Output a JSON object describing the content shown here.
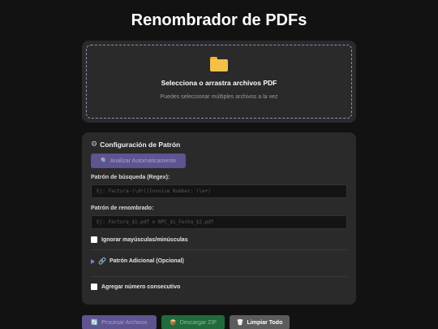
{
  "page": {
    "title": "Renombrador de PDFs"
  },
  "dropzone": {
    "icon": "folder-icon",
    "title": "Selecciona o arrastra archivos PDF",
    "subtitle": "Puedes seleccionar múltiples archivos a la vez"
  },
  "config": {
    "title": "Configuración de Patrón",
    "title_icon": "gear-icon",
    "analyze_label": "Analizar Automáticamente",
    "search_label": "Patrón de búsqueda (Regex):",
    "search_placeholder": "Ej: Factura-(\\d+)|Invoice Number: (\\w+)",
    "rename_label": "Patrón de renombrado:",
    "rename_placeholder": "Ej: Factura_$1.pdf o NPC_$1_Fecha_$2.pdf",
    "ignore_case_label": "Ignorar mayúsculas/minúsculas",
    "ignore_case_checked": false,
    "additional_label": "Patrón Adicional (Opcional)",
    "consecutive_label": "Agregar número consecutivo",
    "consecutive_checked": false
  },
  "actions": {
    "process_label": "Procesar Archivos",
    "zip_label": "Descargar ZIP",
    "clear_label": "Limpiar Todo"
  },
  "colors": {
    "background": "#121212",
    "panel": "#2a2a2a",
    "accent": "#5d5490",
    "download": "#1f6b3c",
    "dashed_border": "#9a86c9"
  }
}
